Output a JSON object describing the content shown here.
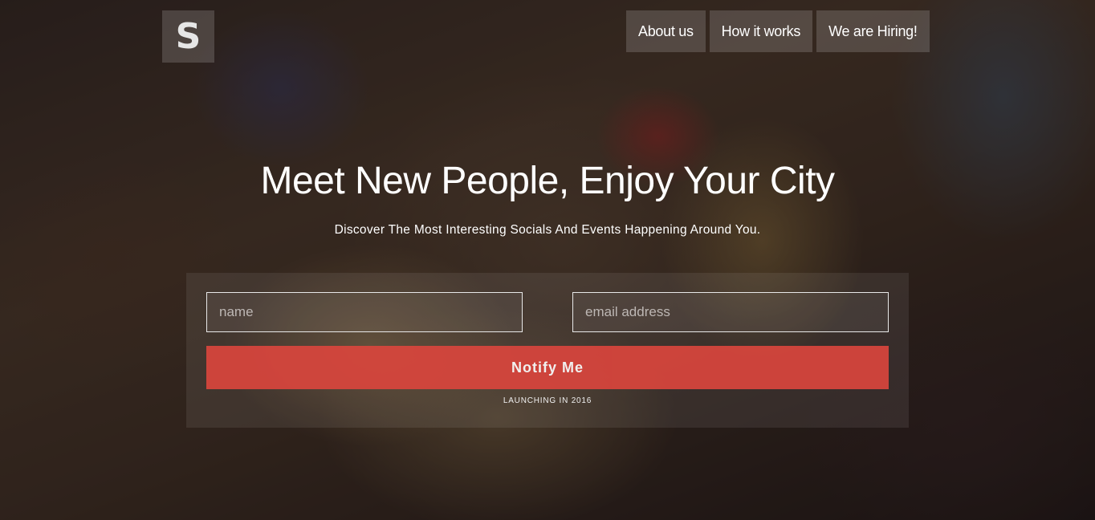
{
  "brand": {
    "logo_letter": "S"
  },
  "nav": {
    "items": [
      {
        "label": "About us"
      },
      {
        "label": "How it works"
      },
      {
        "label": "We are Hiring!"
      }
    ]
  },
  "hero": {
    "title": "Meet New People, Enjoy Your City",
    "subtitle": "Discover The Most Interesting Socials And Events Happening Around You."
  },
  "signup": {
    "name_placeholder": "name",
    "name_value": "",
    "email_placeholder": "email address",
    "email_value": "",
    "button_label": "Notify Me",
    "launch_note": "LAUNCHING IN 2016"
  },
  "colors": {
    "accent": "#d9453d",
    "overlay": "#0f0a0e"
  }
}
